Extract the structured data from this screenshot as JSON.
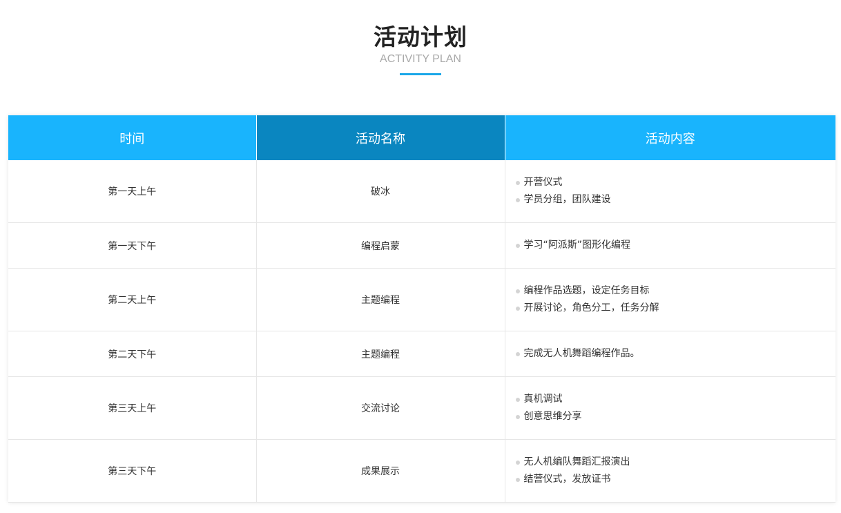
{
  "heading": {
    "title": "活动计划",
    "subtitle": "ACTIVITY PLAN",
    "accent_color": "#1aa7e8"
  },
  "table": {
    "header_color": "#19b4fd",
    "header_active_color": "#0a86c0",
    "headers": [
      "时间",
      "活动名称",
      "活动内容"
    ],
    "rows": [
      {
        "time": "第一天上午",
        "name": "破冰",
        "items": [
          "开营仪式",
          "学员分组，团队建设"
        ]
      },
      {
        "time": "第一天下午",
        "name": "编程启蒙",
        "items": [
          "学习“阿派斯”图形化编程"
        ]
      },
      {
        "time": "第二天上午",
        "name": "主题编程",
        "items": [
          "编程作品选题，设定任务目标",
          "开展讨论，角色分工，任务分解"
        ]
      },
      {
        "time": "第二天下午",
        "name": "主题编程",
        "items": [
          "完成无人机舞蹈编程作品。"
        ]
      },
      {
        "time": "第三天上午",
        "name": "交流讨论",
        "items": [
          "真机调试",
          "创意思维分享"
        ]
      },
      {
        "time": "第三天下午",
        "name": "成果展示",
        "items": [
          "无人机编队舞蹈汇报演出",
          "结营仪式，发放证书"
        ]
      }
    ]
  }
}
